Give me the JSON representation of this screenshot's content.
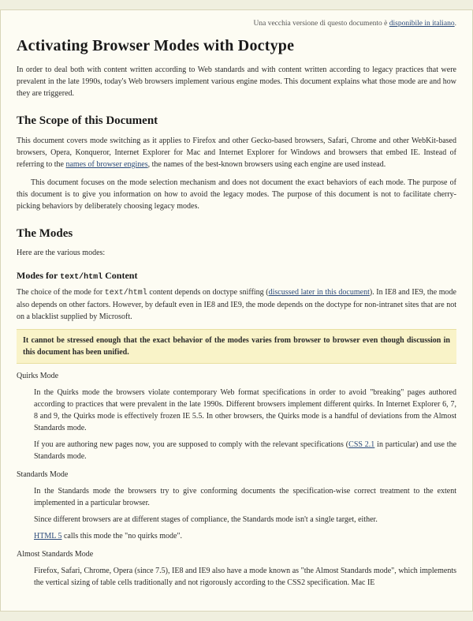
{
  "notice": {
    "prefix": "Una vecchia versione di questo documento è ",
    "link": "disponibile in italiano",
    "suffix": "."
  },
  "title": "Activating Browser Modes with Doctype",
  "intro": "In order to deal both with content written according to Web standards and with content written according to legacy practices that were prevalent in the late 1990s, today's Web browsers implement various engine modes. This document explains what those mode are and how they are triggered.",
  "scope": {
    "heading": "The Scope of this Document",
    "p1a": "This document covers mode switching as it applies to Firefox and other Gecko-based browsers, Safari, Chrome and other WebKit-based browsers, Opera, Konqueror, Internet Explorer for Mac and Internet Explorer for Windows and browsers that embed IE. Instead of referring to the ",
    "p1_link": "names of browser engines",
    "p1b": ", the names of the best-known browsers using each engine are used instead.",
    "p2": "This document focuses on the mode selection mechanism and does not document the exact behaviors of each mode. The purpose of this document is to give you information on how to avoid the legacy modes. The purpose of this document is not to facilitate cherry-picking behaviors by deliberately choosing legacy modes."
  },
  "modes": {
    "heading": "The Modes",
    "lead": "Here are the various modes:",
    "sub_heading_a": "Modes for ",
    "sub_heading_code": "text/html",
    "sub_heading_b": " Content",
    "sub_p_a": "The choice of the mode for ",
    "sub_p_code": "text/html",
    "sub_p_b": " content depends on doctype sniffing (",
    "sub_p_link": "discussed later in this document",
    "sub_p_c": "). In IE8 and IE9, the mode also depends on other factors. However, by default even in IE8 and IE9, the mode depends on the doctype for non-intranet sites that are not on a blacklist supplied by Microsoft.",
    "callout": "It cannot be stressed enough that the exact behavior of the modes varies from browser to browser even though discussion in this document has been unified."
  },
  "quirks": {
    "term": "Quirks Mode",
    "p1": "In the Quirks mode the browsers violate contemporary Web format specifications in order to avoid \"breaking\" pages authored according to practices that were prevalent in the late 1990s. Different browsers implement different quirks. In Internet Explorer 6, 7, 8 and 9, the Quirks mode is effectively frozen IE 5.5. In other browsers, the Quirks mode is a handful of deviations from the Almost Standards mode.",
    "p2a": "If you are authoring new pages now, you are supposed to comply with the relevant specifications (",
    "p2_link": "CSS 2.1",
    "p2b": " in particular) and use the Standards mode."
  },
  "standards": {
    "term": "Standards Mode",
    "p1": "In the Standards mode the browsers try to give conforming documents the specification-wise correct treatment to the extent implemented in a particular browser.",
    "p2": "Since different browsers are at different stages of compliance, the Standards mode isn't a single target, either.",
    "p3_link": "HTML 5",
    "p3b": " calls this mode the \"no quirks mode\"."
  },
  "almost": {
    "term": "Almost Standards Mode",
    "p1": "Firefox, Safari, Chrome, Opera (since 7.5), IE8 and IE9 also have a mode known as \"the Almost Standards mode\", which implements the vertical sizing of table cells traditionally and not rigorously according to the CSS2 specification. Mac IE"
  }
}
